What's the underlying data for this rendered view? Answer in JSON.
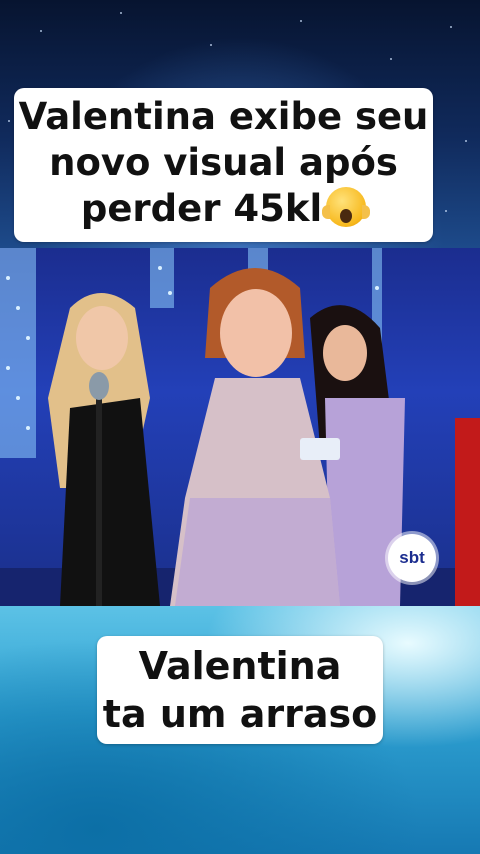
{
  "top_caption": {
    "lines": [
      "Valentina exibe seu",
      "novo visual após",
      "perder 45kl"
    ],
    "emoji": "face-screaming-in-fear-icon"
  },
  "video": {
    "logo": "sbt"
  },
  "bottom_caption": {
    "lines": [
      "Valentina",
      "ta um arraso"
    ]
  },
  "colors": {
    "caption_bg": "#ffffff",
    "caption_text": "#111111",
    "stage_blue": "#2340b8",
    "sky_blue": "#2d9fd0"
  }
}
